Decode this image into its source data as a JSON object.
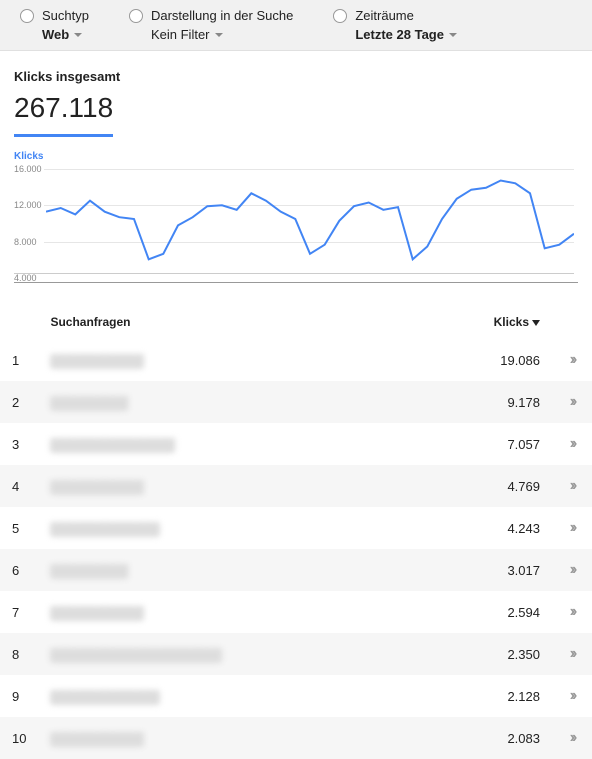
{
  "filters": {
    "search_type": {
      "label": "Suchtyp",
      "value": "Web"
    },
    "display": {
      "label": "Darstellung in der Suche",
      "value": "Kein Filter"
    },
    "timeframe": {
      "label": "Zeiträume",
      "value": "Letzte 28 Tage"
    }
  },
  "summary": {
    "label": "Klicks insgesamt",
    "value": "267.118"
  },
  "chart_data": {
    "type": "line",
    "title": "Klicks",
    "ylabel": "",
    "xlabel": "",
    "ylim": [
      4000,
      16000
    ],
    "yticks": [
      "16.000",
      "12.000",
      "8.000",
      "4.000"
    ],
    "series": [
      {
        "name": "Klicks",
        "values": [
          10800,
          11200,
          10500,
          12000,
          10800,
          10200,
          10000,
          5600,
          6200,
          9300,
          10200,
          11400,
          11500,
          11000,
          12800,
          12000,
          10800,
          10000,
          6200,
          7200,
          9800,
          11400,
          11800,
          11000,
          11300,
          5600,
          7000,
          10000,
          12200,
          13200,
          13400,
          14200,
          13900,
          12800,
          6800,
          7200,
          8400
        ]
      }
    ]
  },
  "table": {
    "columns": {
      "query": "Suchanfragen",
      "klicks": "Klicks"
    },
    "rows": [
      {
        "rank": "1",
        "query": "████████████",
        "klicks": "19.086"
      },
      {
        "rank": "2",
        "query": "██████████",
        "klicks": "9.178"
      },
      {
        "rank": "3",
        "query": "████████████████",
        "klicks": "7.057"
      },
      {
        "rank": "4",
        "query": "████████████",
        "klicks": "4.769"
      },
      {
        "rank": "5",
        "query": "██████████████",
        "klicks": "4.243"
      },
      {
        "rank": "6",
        "query": "██████████",
        "klicks": "3.017"
      },
      {
        "rank": "7",
        "query": "████████████",
        "klicks": "2.594"
      },
      {
        "rank": "8",
        "query": "██████████████████████",
        "klicks": "2.350"
      },
      {
        "rank": "9",
        "query": "██████████████",
        "klicks": "2.128"
      },
      {
        "rank": "10",
        "query": "████████████",
        "klicks": "2.083"
      }
    ]
  }
}
